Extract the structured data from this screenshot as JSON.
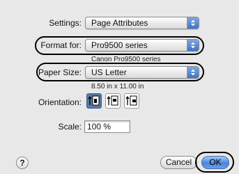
{
  "settings": {
    "label": "Settings:",
    "value": "Page Attributes"
  },
  "format_for": {
    "label": "Format for:",
    "value": "Pro9500 series",
    "caption": "Canon Pro9500 series"
  },
  "paper_size": {
    "label": "Paper Size:",
    "value": "US Letter",
    "caption": "8.50 in x 11.00 in"
  },
  "orientation": {
    "label": "Orientation:",
    "options": [
      "portrait",
      "landscape-left",
      "landscape-right"
    ],
    "selected": "portrait"
  },
  "scale": {
    "label": "Scale:",
    "value": "100 %"
  },
  "buttons": {
    "help": "?",
    "cancel": "Cancel",
    "ok": "OK"
  },
  "colors": {
    "accent": "#4a86db",
    "window_bg": "#e8e8e8",
    "highlight": "#000000"
  }
}
